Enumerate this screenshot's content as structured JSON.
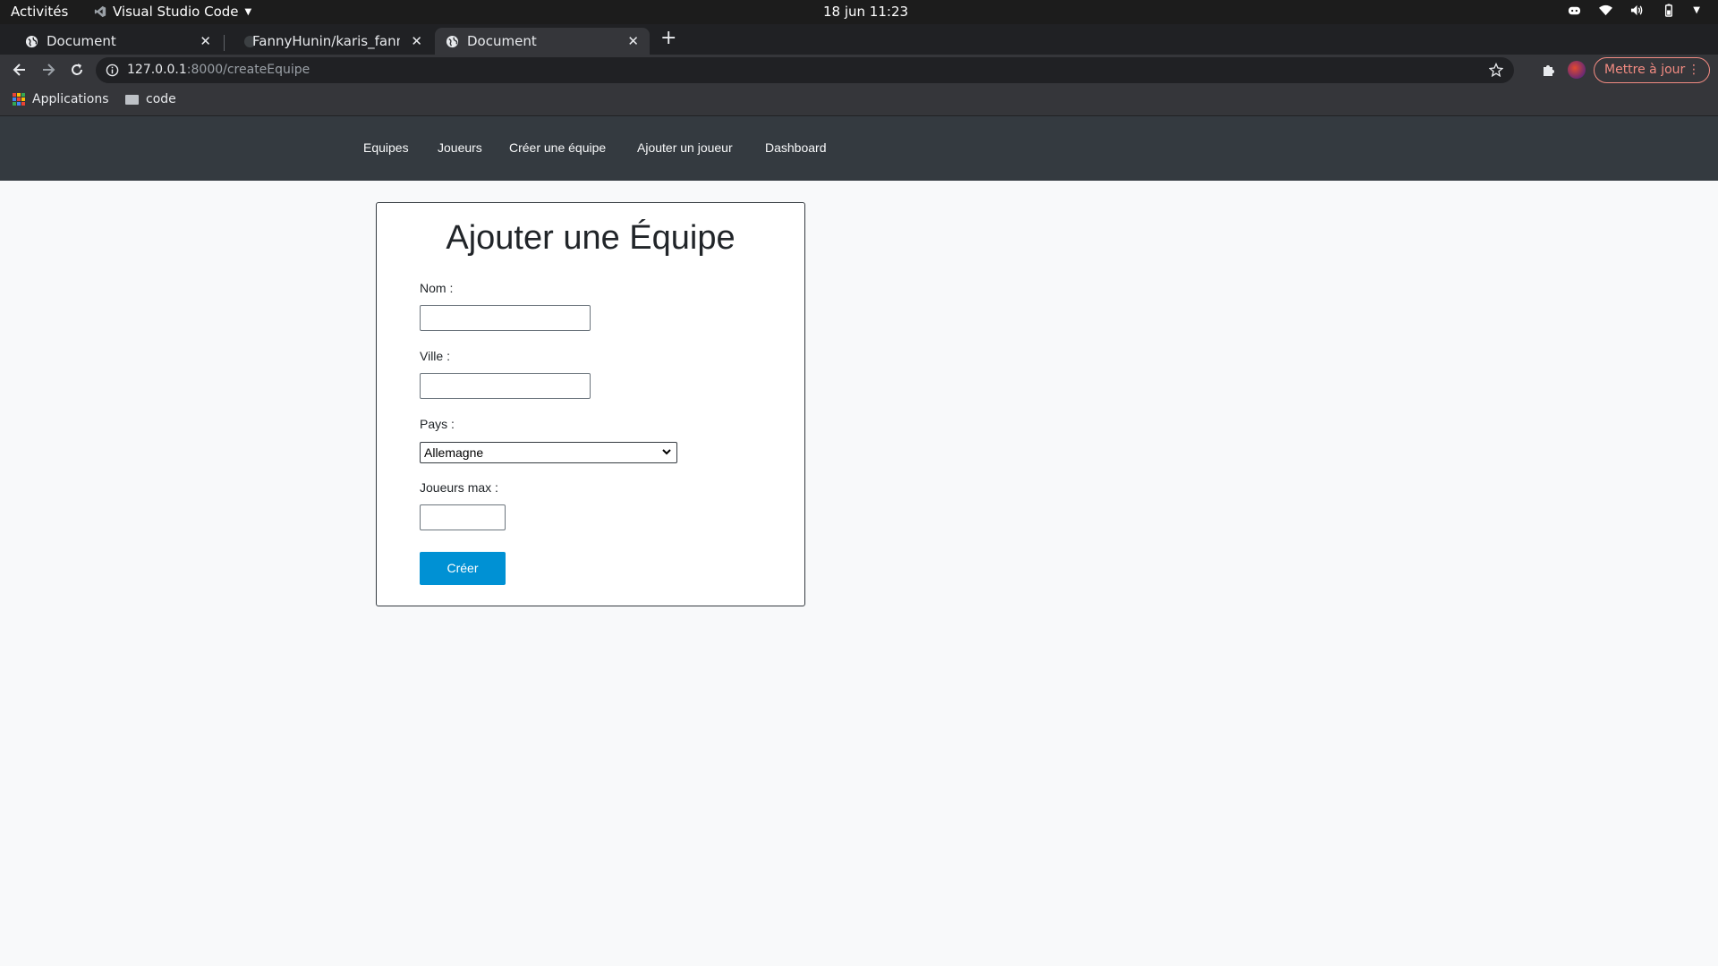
{
  "topbar": {
    "activities": "Activités",
    "app_name": "Visual Studio Code",
    "clock": "18 jun  11:23"
  },
  "tabs": [
    {
      "title": "Document",
      "active": false
    },
    {
      "title": "FannyHunin/karis_fanny_",
      "active": false
    },
    {
      "title": "Document",
      "active": true
    }
  ],
  "toolbar": {
    "url_host": "127.0.0.1",
    "url_path": ":8000/createEquipe",
    "update_label": "Mettre à jour"
  },
  "bookmarks": [
    {
      "label": "Applications",
      "icon": "apps-grid-icon"
    },
    {
      "label": "code",
      "icon": "folder-icon"
    }
  ],
  "site_nav": {
    "items": [
      "Equipes",
      "Joueurs",
      "Créer une équipe",
      "Ajouter un joueur",
      "Dashboard"
    ]
  },
  "form": {
    "title": "Ajouter une Équipe",
    "fields": {
      "nom_label": "Nom :",
      "nom_value": "",
      "ville_label": "Ville :",
      "ville_value": "",
      "pays_label": "Pays :",
      "pays_selected": "Allemagne",
      "joueurs_max_label": "Joueurs max :",
      "joueurs_max_value": ""
    },
    "submit_label": "Créer"
  },
  "colors": {
    "navbar_bg": "#343a40",
    "page_bg": "#f8f9fa",
    "submit_bg": "#0091d4",
    "update_accent": "#f28b82"
  }
}
